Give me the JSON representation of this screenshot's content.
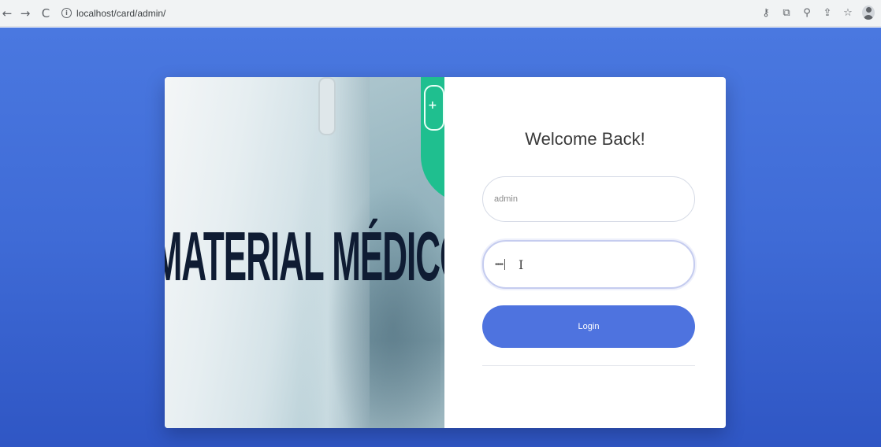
{
  "browser": {
    "back_glyph": "←",
    "forward_glyph": "→",
    "reload_glyph": "C",
    "info_glyph": "i",
    "url": "localhost/card/admin/",
    "icons": [
      "key-icon",
      "translate-icon",
      "zoom-icon",
      "share-icon",
      "star-icon",
      "profile-icon"
    ],
    "icon_glyphs": {
      "key": "⚷",
      "translate": "⧉",
      "zoom": "⚲",
      "share": "⇪",
      "star": "☆"
    }
  },
  "hero": {
    "title": "MATERIAL MÉDICO",
    "accent_color": "#1fbf8f"
  },
  "login": {
    "heading": "Welcome Back!",
    "username_value": "admin",
    "password_value": "••••",
    "cursor_glyph": "I",
    "button_label": "Login",
    "button_color": "#4e73df"
  },
  "page": {
    "background_color": "#4169e1"
  }
}
